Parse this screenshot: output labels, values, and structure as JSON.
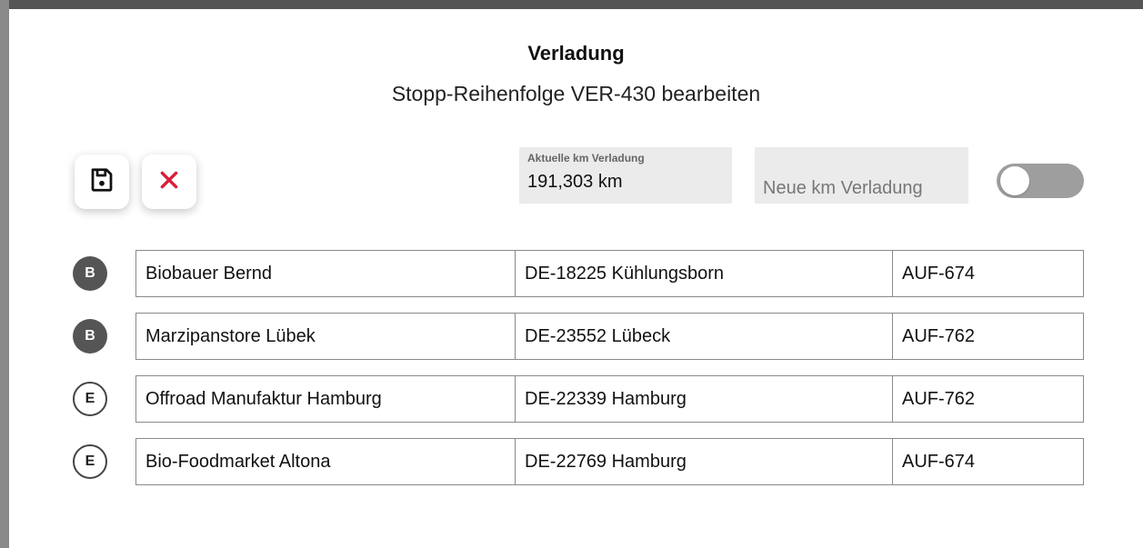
{
  "dialog": {
    "title": "Verladung",
    "subtitle": "Stopp-Reihenfolge VER-430 bearbeiten"
  },
  "toolbar": {
    "save_icon": "floppy-disk-icon",
    "cancel_icon": "close-icon",
    "cancel_color": "#d81e3a"
  },
  "km": {
    "current_label": "Aktuelle km Verladung",
    "current_value": "191,303 km",
    "new_placeholder": "Neue km Verladung",
    "new_value": ""
  },
  "toggle": {
    "on": false
  },
  "stops": [
    {
      "badge": "B",
      "style": "filled",
      "name": "Biobauer Bernd",
      "location": "DE-18225 Kühlungsborn",
      "order": "AUF-674"
    },
    {
      "badge": "B",
      "style": "filled",
      "name": "Marzipanstore Lübek",
      "location": "DE-23552 Lübeck",
      "order": "AUF-762"
    },
    {
      "badge": "E",
      "style": "outline",
      "name": "Offroad Manufaktur Hamburg",
      "location": "DE-22339 Hamburg",
      "order": "AUF-762"
    },
    {
      "badge": "E",
      "style": "outline",
      "name": "Bio-Foodmarket Altona",
      "location": "DE-22769 Hamburg",
      "order": "AUF-674"
    }
  ]
}
